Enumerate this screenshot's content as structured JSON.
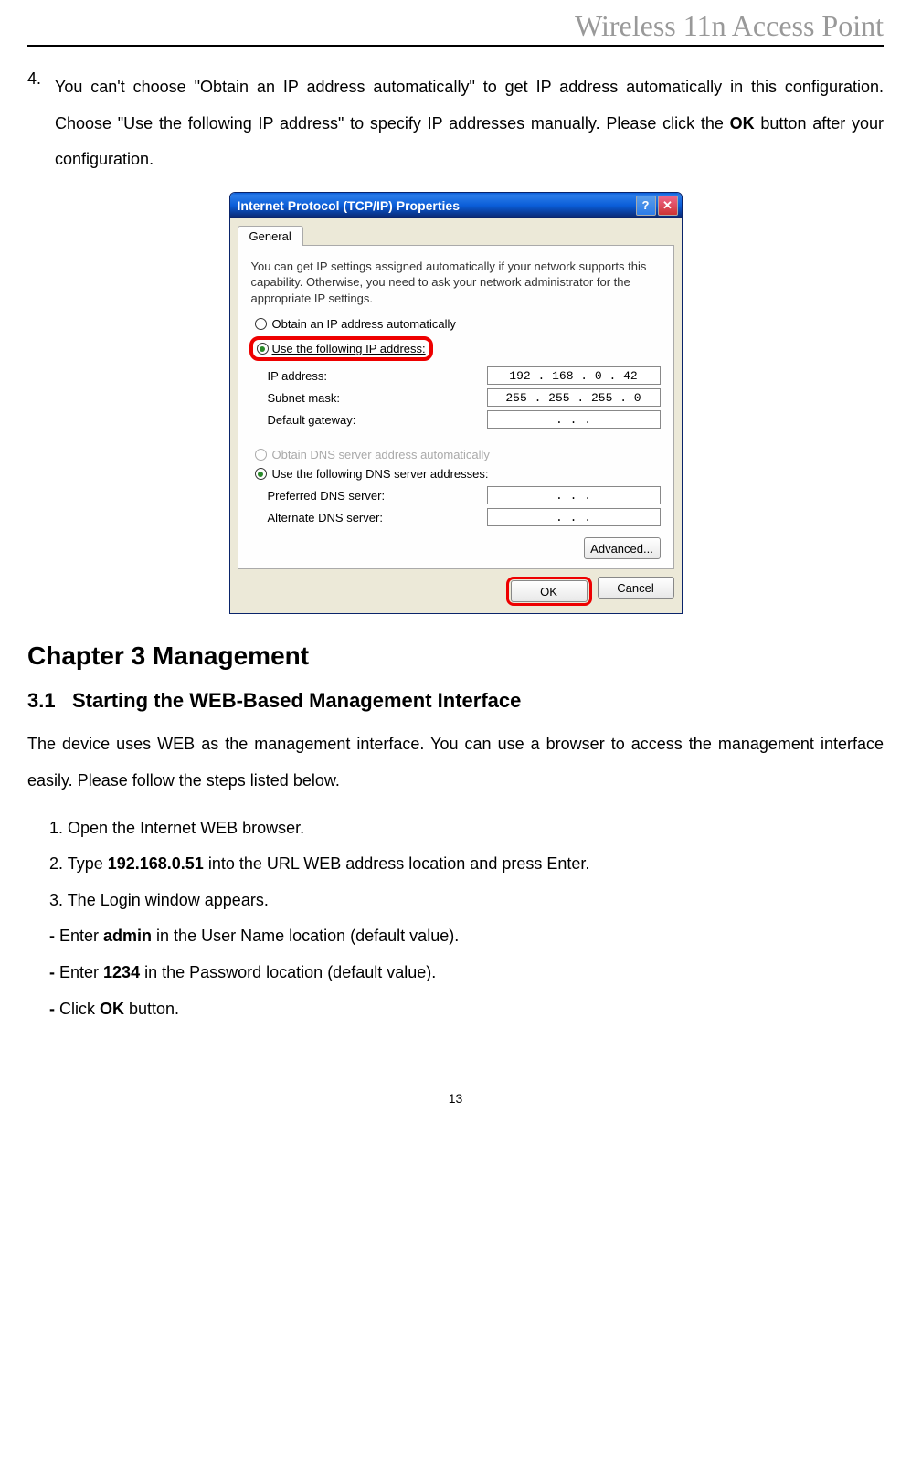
{
  "header": {
    "title": "Wireless 11n Access Point"
  },
  "item4": {
    "number": "4.",
    "text_part1": "You can't choose \"Obtain an IP address automatically\" to get IP address automatically in this configuration. Choose \"Use the following IP address\" to specify IP addresses manually. Please click the ",
    "text_bold": "OK",
    "text_part2": " button after your configuration."
  },
  "dialog": {
    "title": "Internet Protocol (TCP/IP) Properties",
    "tab": "General",
    "info": "You can get IP settings assigned automatically if your network supports this capability. Otherwise, you need to ask your network administrator for the appropriate IP settings.",
    "radio_obtain_ip": "Obtain an IP address automatically",
    "radio_use_ip": "Use the following IP address:",
    "label_ip": "IP address:",
    "value_ip": "192 . 168 .  0  . 42",
    "label_subnet": "Subnet mask:",
    "value_subnet": "255 . 255 . 255 .  0",
    "label_gateway": "Default gateway:",
    "value_gateway": ".       .       .",
    "radio_obtain_dns": "Obtain DNS server address automatically",
    "radio_use_dns": "Use the following DNS server addresses:",
    "label_pref_dns": "Preferred DNS server:",
    "value_pref_dns": ".       .       .",
    "label_alt_dns": "Alternate DNS server:",
    "value_alt_dns": ".       .       .",
    "btn_advanced": "Advanced...",
    "btn_ok": "OK",
    "btn_cancel": "Cancel"
  },
  "chapter": {
    "title": "Chapter 3    Management"
  },
  "section": {
    "number": "3.1",
    "title": "Starting the WEB-Based Management Interface",
    "intro": "The device uses WEB as the management interface. You can use a browser to access the management interface easily. Please follow the steps listed below.",
    "step1": "1. Open the Internet WEB browser.",
    "step2_a": "2. Type ",
    "step2_bold": "192.168.0.51",
    "step2_b": " into the URL WEB address location and press Enter.",
    "step3": "3. The Login window appears.",
    "sub1_a": "- ",
    "sub1_b": "Enter ",
    "sub1_bold": "admin",
    "sub1_c": " in the User Name location (default value).",
    "sub2_a": "- ",
    "sub2_b": "Enter ",
    "sub2_bold": "1234",
    "sub2_c": " in the Password location (default value).",
    "sub3_a": "- ",
    "sub3_b": "Click ",
    "sub3_bold": "OK",
    "sub3_c": " button."
  },
  "page_number": "13"
}
